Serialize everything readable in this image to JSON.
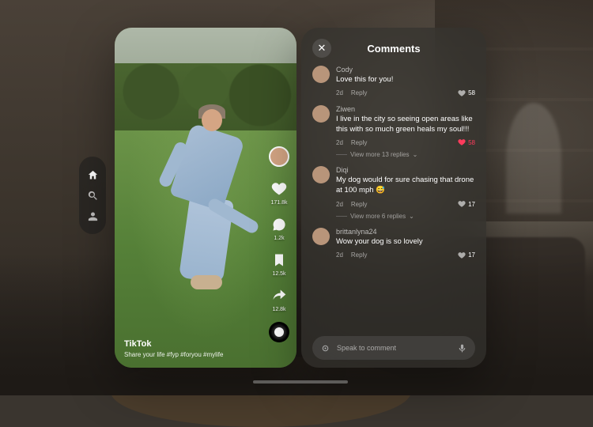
{
  "nav": {
    "home": "home",
    "search": "search",
    "profile": "profile"
  },
  "video": {
    "username": "TikTok",
    "caption": "Share your life #fyp #foryou #mylife",
    "actions": {
      "likes": "171.8k",
      "comments": "1.2k",
      "saves": "12.5k",
      "shares": "12.8k"
    }
  },
  "comments": {
    "title": "Comments",
    "close": "✕",
    "input_placeholder": "Speak to comment",
    "items": [
      {
        "name": "Cody",
        "text": "Love this for you!",
        "time": "2d",
        "reply": "Reply",
        "likes": "58",
        "liked": false,
        "more": ""
      },
      {
        "name": "Ziwen",
        "text": "I live in the city so seeing open areas like this with so much green heals my soul!!!",
        "time": "2d",
        "reply": "Reply",
        "likes": "58",
        "liked": true,
        "more": "View more 13 replies"
      },
      {
        "name": "Diqi",
        "text": "My dog would for sure chasing that drone at 100 mph 😅",
        "time": "2d",
        "reply": "Reply",
        "likes": "17",
        "liked": false,
        "more": "View more 6 replies"
      },
      {
        "name": "brittanlyna24",
        "text": "Wow your dog is so lovely",
        "time": "2d",
        "reply": "Reply",
        "likes": "17",
        "liked": false,
        "more": ""
      }
    ]
  }
}
